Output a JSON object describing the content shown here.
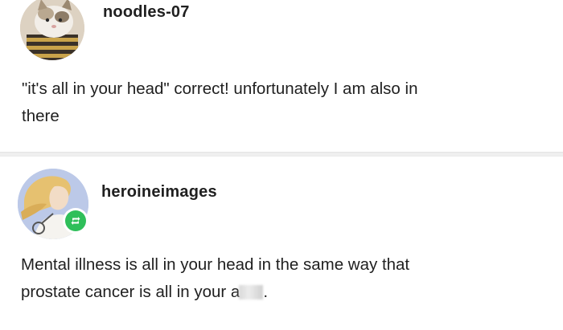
{
  "posts": [
    {
      "username": "noodles-07",
      "avatar": "cat-avatar",
      "text_lines": [
        "\"it's all in your head\" correct! unfortunately I am also in",
        "there"
      ]
    },
    {
      "username": "heroineimages",
      "avatar": "heroine-illustration-avatar",
      "badge": "reblog-icon",
      "text_lines": [
        "Mental illness is all in your head in the same way that",
        "prostate cancer is all in your a"
      ],
      "text_suffix": "."
    }
  ],
  "colors": {
    "text": "#1f1f1f",
    "divider": "#e4e4e4",
    "reblog_green": "#2fbf5a"
  }
}
